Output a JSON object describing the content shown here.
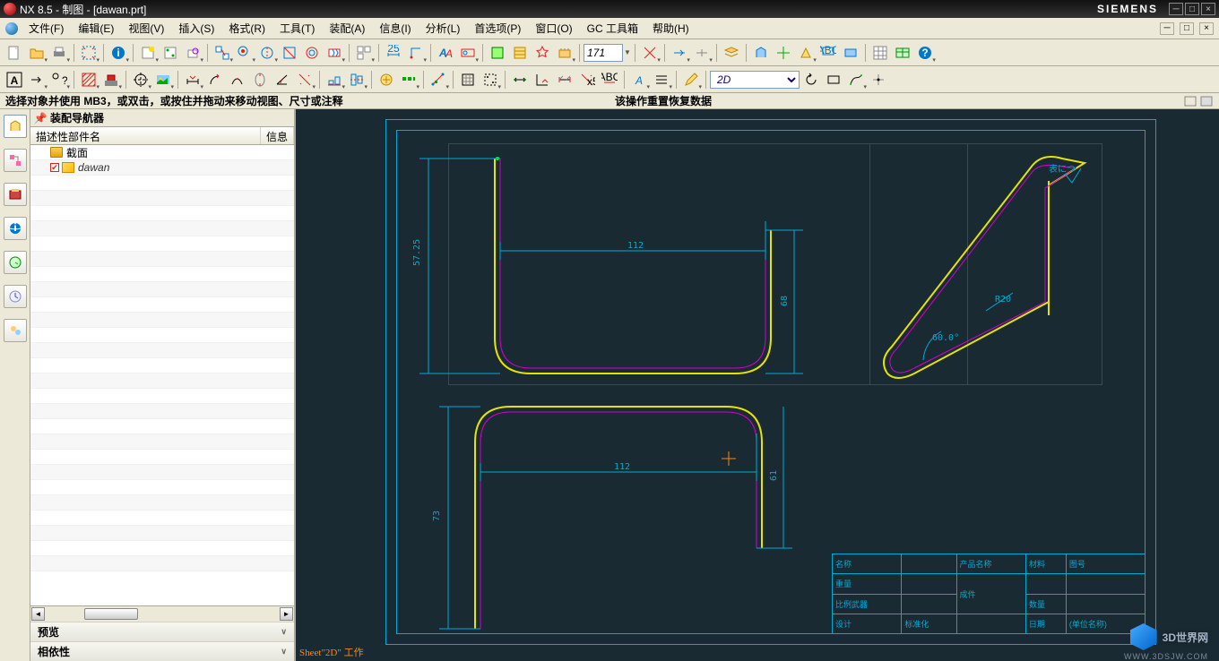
{
  "title": "NX 8.5 - 制图 - [dawan.prt]",
  "brand": "SIEMENS",
  "menu": [
    "文件(F)",
    "编辑(E)",
    "视图(V)",
    "插入(S)",
    "格式(R)",
    "工具(T)",
    "装配(A)",
    "信息(I)",
    "分析(L)",
    "首选项(P)",
    "窗口(O)",
    "GC 工具箱",
    "帮助(H)"
  ],
  "prompt_left": "选择对象并使用 MB3，或双击，或按住并拖动来移动视图、尺寸或注释",
  "prompt_right": "该操作重置恢复数据",
  "dim_value": "171",
  "layer_select": "2D",
  "nav": {
    "title": "装配导航器",
    "col1": "描述性部件名",
    "col2": "信息",
    "items": [
      {
        "label": "截面",
        "type": "folder"
      },
      {
        "label": "dawan",
        "type": "part",
        "checked": true
      }
    ],
    "preview": "预览",
    "deps": "相依性"
  },
  "dims": {
    "d112_1": "112",
    "d112_2": "112",
    "dv1": "57.25",
    "dv2": "68",
    "dv3": "73",
    "dv4": "61",
    "angle": "60.0°",
    "rad": "R20",
    "surf": "表につ"
  },
  "sheet_label": "Sheet\"2D\" 工作",
  "titleblock": {
    "r1c1": "名称",
    "r1c2": "产品名称",
    "r1c3": "材料",
    "r1c4": "图号",
    "r2c1": "重量",
    "r2c2": "成件",
    "r3c1": "比例武器",
    "r3c2": "数量",
    "r4c1": "设计",
    "r4c2": "标准化",
    "r4c3": "日期",
    "r4c4": "(单位名称)"
  },
  "watermark": {
    "text": "3D世界网",
    "url": "WWW.3DSJW.COM"
  }
}
